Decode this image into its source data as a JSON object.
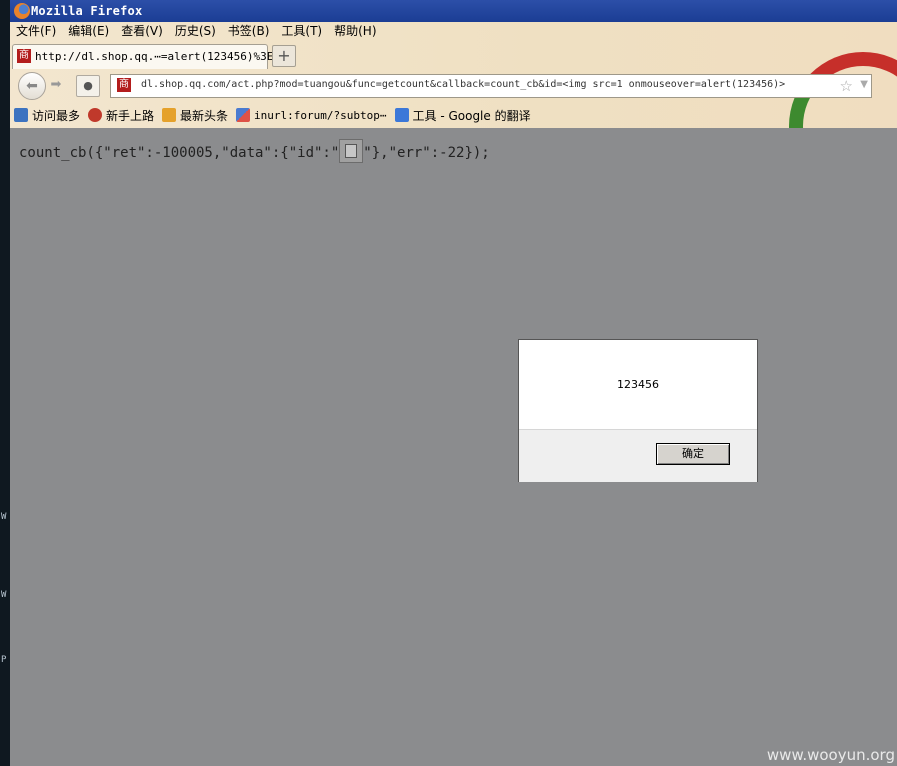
{
  "window": {
    "title": "Mozilla Firefox"
  },
  "menu": [
    "文件(F)",
    "编辑(E)",
    "查看(V)",
    "历史(S)",
    "书签(B)",
    "工具(T)",
    "帮助(H)"
  ],
  "tab": {
    "favicon_text": "商",
    "title": "http://dl.shop.qq.⋯=alert(123456)%3E",
    "new_tab": "+"
  },
  "nav": {
    "url": "dl.shop.qq.com/act.php?mod=tuangou&func=getcount&callback=count_cb&id=<img src=1 onmouseover=alert(123456)>",
    "url_favicon_text": "商"
  },
  "bookmarks": [
    {
      "label": "访问最多",
      "icon": "most-visited-icon",
      "color": "#3d73c0"
    },
    {
      "label": "新手上路",
      "icon": "getting-started-icon",
      "color": "#c0392b"
    },
    {
      "label": "最新头条",
      "icon": "rss-feed-icon",
      "color": "#e5a12b"
    },
    {
      "label": "inurl:forum/?subtop⋯",
      "icon": "google-icon",
      "color": "#4a7bd0"
    },
    {
      "label": "工具 - Google 的翻译",
      "icon": "translate-icon",
      "color": "#3c78d8"
    }
  ],
  "page": {
    "response_before": "count_cb({\"ret\":-100005,\"data\":{\"id\":\"",
    "response_after": "\"},\"err\":-22});"
  },
  "alert": {
    "message": "123456",
    "ok_label": "确定"
  },
  "left_strip": [
    "W",
    "W",
    "P"
  ],
  "watermark": "www.wooyun.org"
}
